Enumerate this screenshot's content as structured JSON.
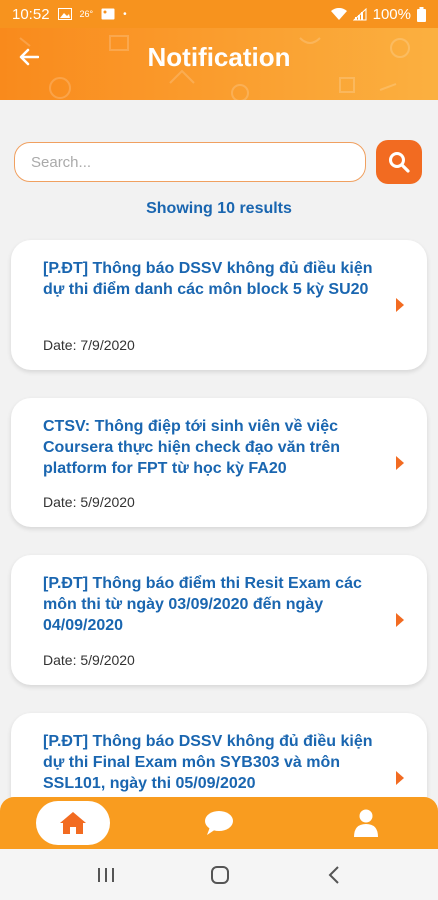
{
  "status_bar": {
    "time": "10:52",
    "temperature": "26°",
    "battery": "100%"
  },
  "header": {
    "title": "Notification"
  },
  "search": {
    "placeholder": "Search...",
    "value": ""
  },
  "results": {
    "label": "Showing 10 results"
  },
  "notifications": [
    {
      "title": "[P.ĐT] Thông báo DSSV không đủ điều kiện dự thi điểm danh các môn block 5 kỳ SU20",
      "date": "Date: 7/9/2020"
    },
    {
      "title": "CTSV: Thông điệp tới sinh viên về việc Coursera thực hiện check đạo văn trên platform for FPT từ học kỳ FA20",
      "date": "Date: 5/9/2020"
    },
    {
      "title": "[P.ĐT] Thông báo điểm thi Resit Exam các môn thi từ ngày 03/09/2020 đến ngày 04/09/2020",
      "date": "Date: 5/9/2020"
    },
    {
      "title": "[P.ĐT] Thông báo DSSV không đủ điều kiện dự thi Final Exam môn SYB303 và môn SSL101, ngày thi 05/09/2020",
      "date": ""
    }
  ],
  "colors": {
    "accent": "#f7931e",
    "title_blue": "#1a66b0",
    "search_button": "#f26b21",
    "arrow": "#f26b21"
  },
  "bottom_nav": {
    "items": [
      "home-icon",
      "chat-icon",
      "profile-icon"
    ],
    "active": "home-icon"
  }
}
